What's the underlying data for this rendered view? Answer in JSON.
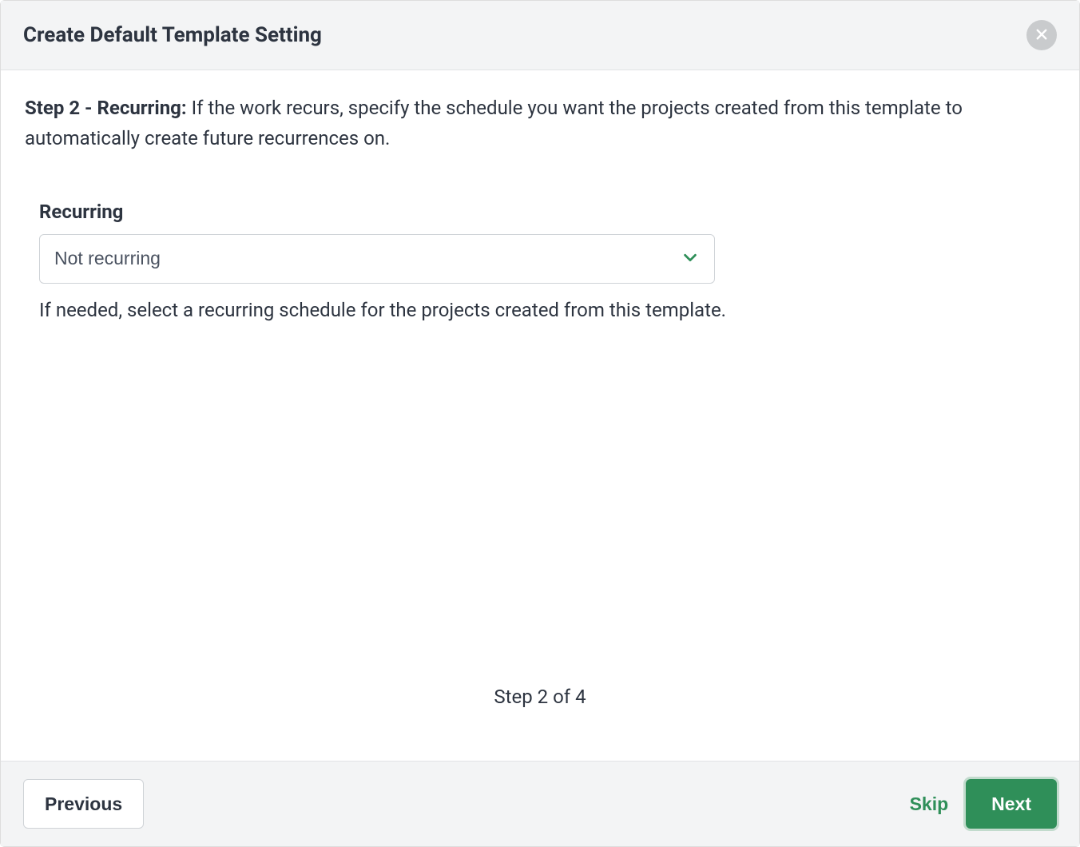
{
  "header": {
    "title": "Create Default Template Setting"
  },
  "body": {
    "step_label": "Step 2 - Recurring:",
    "step_description": " If the work recurs, specify the schedule you want the projects created from this template to automatically create future recurrences on.",
    "field_label": "Recurring",
    "select_value": "Not recurring",
    "helper_text": "If needed, select a recurring schedule for the projects created from this template.",
    "step_indicator": "Step 2 of 4"
  },
  "footer": {
    "previous_label": "Previous",
    "skip_label": "Skip",
    "next_label": "Next"
  },
  "colors": {
    "accent": "#2f8f59"
  }
}
